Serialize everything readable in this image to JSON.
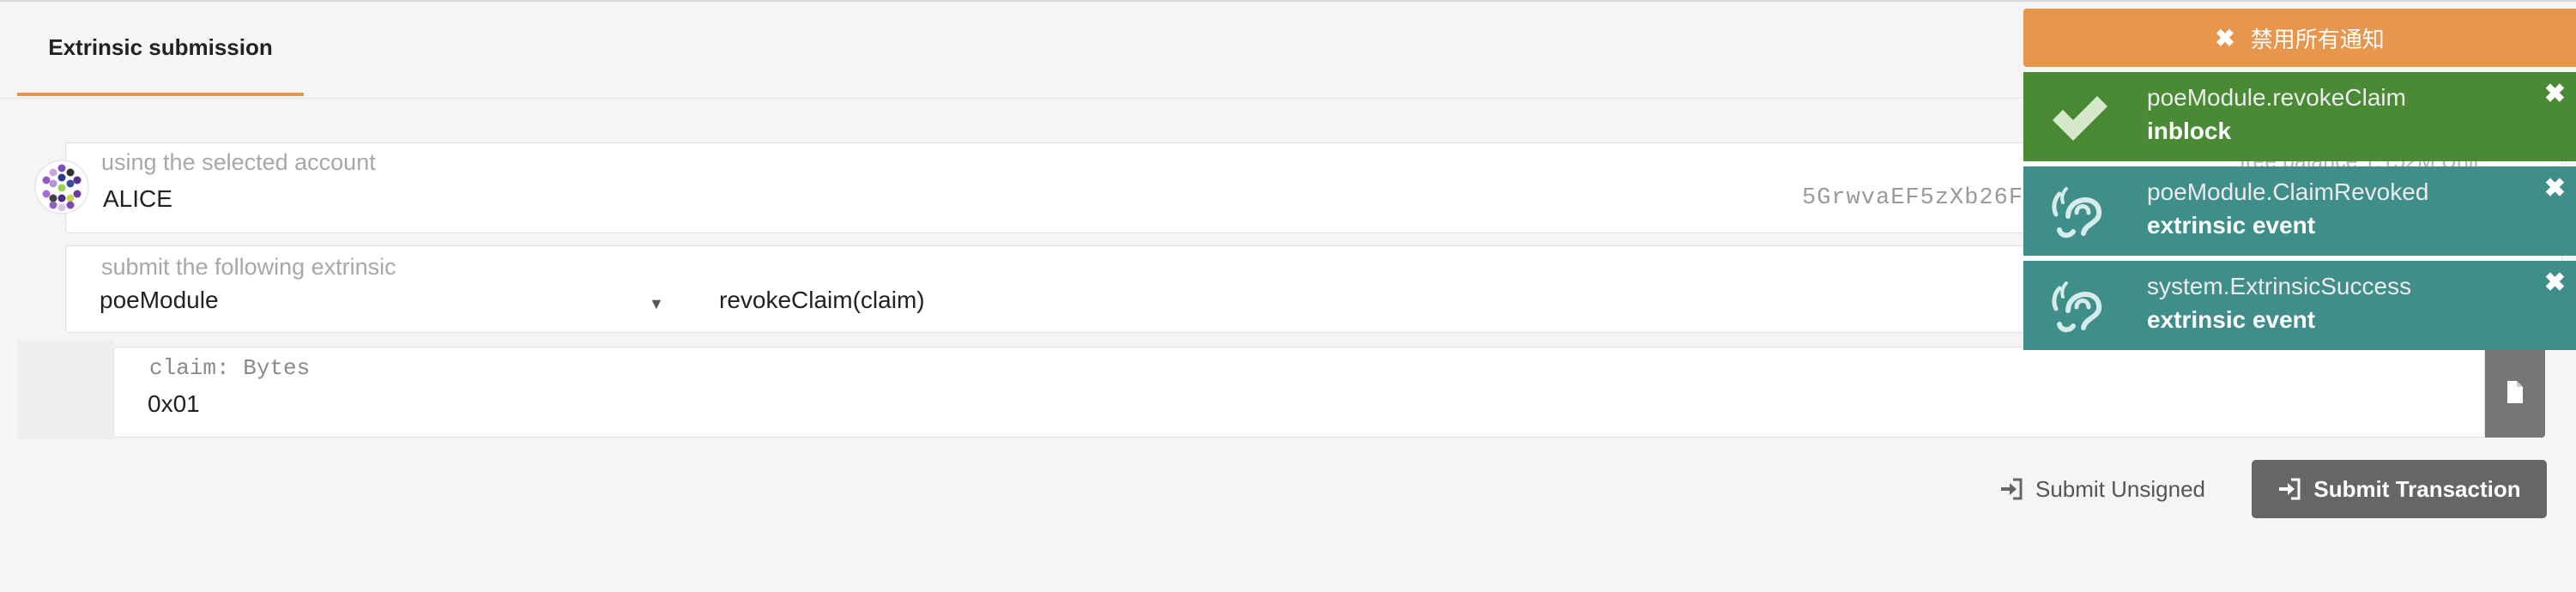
{
  "tabs": [
    {
      "label": "Extrinsic submission"
    }
  ],
  "account": {
    "label": "using the selected account",
    "name": "ALICE",
    "address": "5GrwvaEF5zXb26F",
    "balance_label": "free balance 1.152M Unit"
  },
  "extrinsic": {
    "label": "submit the following extrinsic",
    "section": "poeModule",
    "method": "revokeClaim(claim)"
  },
  "param": {
    "label": "claim: Bytes",
    "value": "0x01"
  },
  "actions": {
    "submit_unsigned": "Submit Unsigned",
    "submit_transaction": "Submit Transaction"
  },
  "notifications": {
    "dismiss_all": "禁用所有通知",
    "items": [
      {
        "title": "poeModule.revokeClaim",
        "status": "inblock",
        "color": "#4a8a35",
        "icon": "check-icon"
      },
      {
        "title": "poeModule.ClaimRevoked",
        "status": "extrinsic event",
        "color": "#3f8e8a",
        "icon": "hearing-icon"
      },
      {
        "title": "system.ExtrinsicSuccess",
        "status": "extrinsic event",
        "color": "#3f8e8a",
        "icon": "hearing-icon"
      }
    ]
  },
  "colors": {
    "accent": "#e7964c",
    "toast_success": "#4a8a35",
    "toast_event": "#3f8e8a",
    "button_dark": "#666666"
  }
}
